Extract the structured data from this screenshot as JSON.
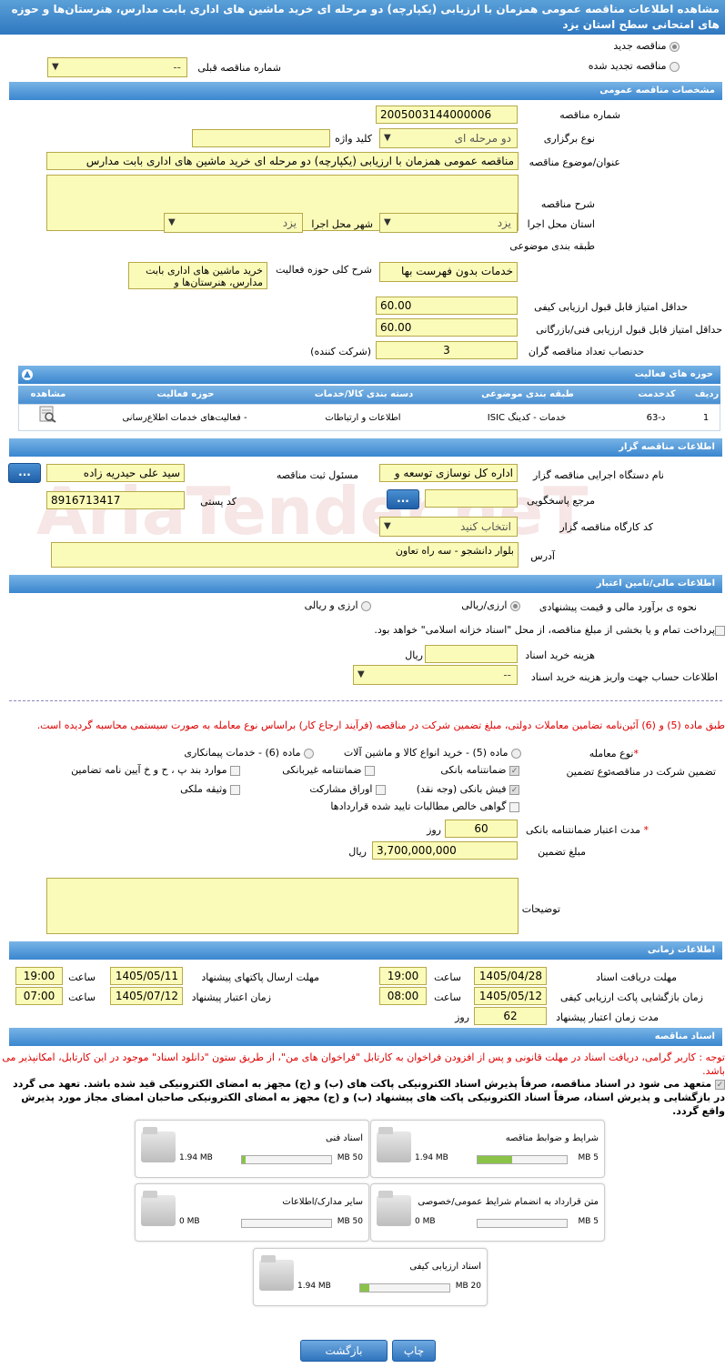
{
  "title": "مشاهده اطلاعات مناقصه عمومی همزمان با ارزیابی (یکپارچه) دو مرحله ای خرید ماشین های اداری بابت مدارس، هنرستان‌ها و حوزه های امتحانی سطح استان یزد",
  "watermark": "AriaTender.neT",
  "top": {
    "new_tender": "مناقصه جدید",
    "renewed_tender": "مناقصه تجدید شده",
    "prev_number_label": "شماره مناقصه قبلی",
    "prev_number_value": "--"
  },
  "general": {
    "header": "مشخصات مناقصه عمومی",
    "number_label": "شماره مناقصه",
    "number_value": "2005003144000006",
    "holding_label": "نوع برگزاری",
    "holding_value": "دو مرحله ای",
    "keyword_label": "کلید واژه",
    "keyword_value": "",
    "subject_label": "عنوان/موضوع مناقصه",
    "subject_value": "مناقصه عمومی همزمان با ارزیابی (یکپارچه) دو مرحله ای خرید ماشین های اداری بابت مدارس",
    "desc_label": "شرح مناقصه",
    "desc_value": "",
    "province_label": "استان محل اجرا",
    "province_value": "یزد",
    "city_label": "شهر محل اجرا",
    "city_value": "یزد",
    "category_label": "طبقه بندی موضوعی",
    "category_value": "خدمات بدون فهرست بها",
    "scope_label": "شرح کلی حوزه فعالیت",
    "scope_value": "خرید ماشین های اداری بابت مدارس، هنرستان‌ها و",
    "min_quality_label": "حداقل امتیاز قابل قبول ارزیابی کیفی",
    "min_quality_value": "60.00",
    "min_tech_label": "حداقل امتیاز قابل قبول ارزیابی فنی/بازرگانی",
    "min_tech_value": "60.00",
    "quorum_label": "حدنصاب تعداد مناقصه گران",
    "quorum_value": "3",
    "quorum_unit": "(شرکت کننده)"
  },
  "activity": {
    "header": "حوزه های فعالیت",
    "columns": [
      "ردیف",
      "کدخدمت",
      "طبقه بندی موضوعی",
      "دسته بندی کالا/خدمات",
      "حوزه فعالیت",
      "مشاهده"
    ],
    "rows": [
      {
        "row": "1",
        "code": "د-63",
        "category": "خدمات - کدینگ ISIC",
        "group": "اطلاعات و ارتباطات",
        "scope": "- فعالیت‌های خدمات اطلاع‌رسانی"
      }
    ]
  },
  "organizer": {
    "header": "اطلاعات مناقصه گزار",
    "org_label": "نام دستگاه اجرایی مناقصه گزار",
    "org_value": "اداره کل نوسازی   توسعه و",
    "resp_label": "مسئول ثبت مناقصه",
    "resp_value": "سید علی حیدریه زاده",
    "ref_label": "مرجع پاسخگویی",
    "ref_value": "",
    "postal_label": "کد پستی",
    "postal_value": "8916713417",
    "workshop_label": "کد کارگاه مناقصه گزار",
    "workshop_value": "انتخاب کنید",
    "address_label": "آدرس",
    "address_value": "بلوار دانشجو - سه راه تعاون",
    "dots": "..."
  },
  "finance": {
    "header": "اطلاعات مالی/تامین اعتبار",
    "method_label": "نحوه ی برآورد مالی و قیمت پیشنهادی",
    "opt1": "ارزی/ریالی",
    "opt2": "ارزی و ریالی",
    "treasury_text": "پرداخت تمام و یا بخشی از مبلغ مناقصه، از محل \"اسناد خزانه اسلامی\" خواهد بود.",
    "doc_cost_label": "هزینه خرید اسناد",
    "doc_cost_value": "",
    "doc_cost_unit": "ریال",
    "account_label": "اطلاعات حساب جهت واریز هزینه خرید اسناد",
    "account_value": "--"
  },
  "guarantee": {
    "note": "طبق ماده (5) و (6) آئین‌نامه تضامین معاملات دولتی، مبلغ تضمین شرکت در مناقصه (فرآیند ارجاع کار) براساس نوع معامله به صورت سیستمی محاسبه گردیده است.",
    "deal_type_label": "نوع معامله",
    "deal_star": "*",
    "deal_opt1": "ماده (5) - خرید انواع کالا و ماشین آلات",
    "deal_opt2": "ماده (6) - خدمات پیمانکاری",
    "guar_label": "تضمین شرکت در مناقصه:",
    "guar_type_label": "نوع تضمین",
    "g1": "ضمانتنامه بانکی",
    "g2": "ضمانتنامه غیربانکی",
    "g3": "موارد بند پ ، ح و خ آیین نامه تضامین",
    "g4": "فیش بانکی (وجه نقد)",
    "g5": "اوراق مشارکت",
    "g6": "وثیقه ملکی",
    "g7": "گواهی خالص مطالبات تایید شده قراردادها",
    "validity_label": "مدت اعتبار ضمانتنامه بانکی",
    "validity_value": "60",
    "validity_unit": "روز",
    "amount_label": "مبلغ تضمین",
    "amount_value": "3,700,000,000",
    "amount_unit": "ریال",
    "notes_label": "توضیحات",
    "notes_value": ""
  },
  "timing": {
    "header": "اطلاعات زمانی",
    "recv_label": "مهلت دریافت اسناد",
    "recv_date": "1405/04/28",
    "recv_time": "19:00",
    "send_label": "مهلت ارسال پاکتهای پیشنهاد",
    "send_date": "1405/05/11",
    "send_time": "19:00",
    "open_label": "زمان بازگشایی پاکت ارزیابی کیفی",
    "open_date": "1405/05/12",
    "open_time": "08:00",
    "valid_label": "زمان اعتبار پیشنهاد",
    "valid_date": "1405/07/12",
    "valid_time": "07:00",
    "dur_label": "مدت زمان اعتبار پیشنهاد",
    "dur_value": "62",
    "dur_unit": "روز",
    "time_word": "ساعت"
  },
  "docs": {
    "header": "اسناد مناقصه",
    "notice": "توجه : کاربر گرامی، دریافت اسناد در مهلت قانونی و پس از افزودن فراخوان به کارتابل \"فراخوان های من\"، از طریق ستون \"دانلود اسناد\" موجود در این کارتابل، امکانپذیر می باشد.",
    "commit": "متعهد می شود در اسناد مناقصه، صرفاً پذیرش اسناد الکترونیکی پاکت های (ب) و (ج) مجهز به امضای الکترونیکی قید شده باشد. تعهد می گردد در بازگشایی و پذیرش اسناد، صرفاً اسناد الکترونیکی پاکت های پیشنهاد (ب) و (ج) مجهز به امضای الکترونیکی صاحبان امضای مجاز مورد پذیرش واقع گردد.",
    "files": [
      {
        "title": "شرایط و ضوابط مناقصه",
        "size": "1.94 MB",
        "max": "5 MB",
        "fill": 0.39
      },
      {
        "title": "اسناد فنی",
        "size": "1.94 MB",
        "max": "50 MB",
        "fill": 0.04
      },
      {
        "title": "متن قرارداد به انضمام شرایط عمومی/خصوصی",
        "size": "0 MB",
        "max": "5 MB",
        "fill": 0
      },
      {
        "title": "سایر مدارک/اطلاعات",
        "size": "0 MB",
        "max": "50 MB",
        "fill": 0
      },
      {
        "title": "اسناد ارزیابی کیفی",
        "size": "1.94 MB",
        "max": "20 MB",
        "fill": 0.1
      }
    ]
  },
  "buttons": {
    "back": "بازگشت",
    "print": "چاپ"
  },
  "colors": {
    "header_blue": "#3a86cf",
    "field_yellow": "#fbfbb9",
    "warning_red": "#dd0000"
  }
}
